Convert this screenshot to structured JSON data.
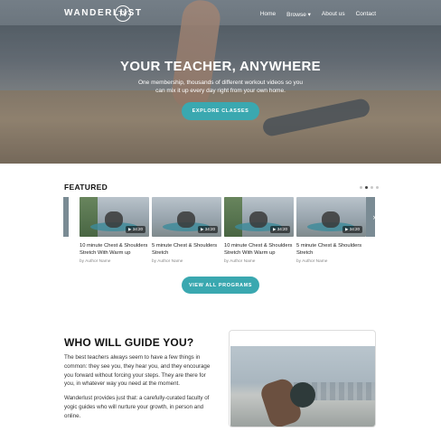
{
  "brand": {
    "name": "WANDERLUST",
    "tv": "TV"
  },
  "nav": {
    "items": [
      "Home",
      "Browse ▾",
      "About us",
      "Contact"
    ]
  },
  "hero": {
    "title": "YOUR TEACHER, ANYWHERE",
    "subtitle": "One membership, thousands of different workout videos so you can mix it up every day right from your own home.",
    "cta": "EXPLORE CLASSES"
  },
  "featured": {
    "title": "FEATURED",
    "cards": [
      {
        "title": "10 minute Chest & Shoulders Stretch With Warm up",
        "author": "by Author Name",
        "duration": "▶ 34:20"
      },
      {
        "title": "5 minute Chest & Shoulders Stretch",
        "author": "by Author Name",
        "duration": "▶ 34:20"
      },
      {
        "title": "10 minute Chest & Shoulders Stretch With Warm up",
        "author": "by Author Name",
        "duration": "▶ 34:20"
      },
      {
        "title": "5 minute Chest & Shoulders Stretch",
        "author": "by Author Name",
        "duration": "▶ 34:20"
      }
    ],
    "cta": "VIEW ALL PROGRAMS",
    "carousel_dots": 4,
    "active_dot": 1
  },
  "guide": {
    "title": "WHO WILL GUIDE YOU?",
    "paragraph1": "The best teachers always seem to have a few things in common: they see you, they hear you, and they encourage you forward without forcing your steps. They are there for you, in whatever way you need at the moment.",
    "paragraph2": "Wanderlust provides just that: a carefully-curated faculty of yogic guides who will nurture your growth, in person and online."
  },
  "colors": {
    "accent": "#3aa8b0"
  }
}
